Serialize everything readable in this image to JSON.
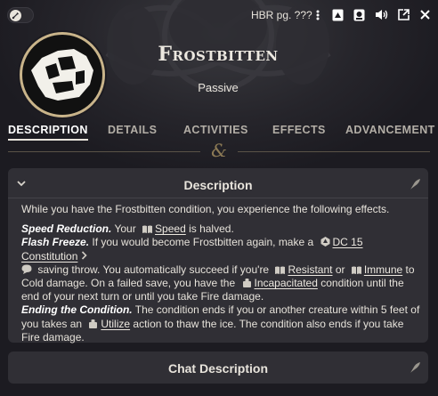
{
  "topbar": {
    "source_label": "HBR pg. ???",
    "icons": [
      "wrench-toggle-icon",
      "menu-dots-icon",
      "open-book-icon",
      "token-icon",
      "volume-icon",
      "pop-out-icon",
      "close-icon"
    ]
  },
  "header": {
    "name": "Frostbitten",
    "type": "Passive"
  },
  "tabs": [
    {
      "label": "DESCRIPTION",
      "active": true
    },
    {
      "label": "DETAILS",
      "active": false
    },
    {
      "label": "ACTIVITIES",
      "active": false
    },
    {
      "label": "EFFECTS",
      "active": false
    },
    {
      "label": "ADVANCEMENT",
      "active": false
    }
  ],
  "divider_glyph": "&",
  "description": {
    "title": "Description",
    "intro": "While you have the Frostbitten condition, you experience the following effects.",
    "speed_title": "Speed Reduction.",
    "speed_pre": " Your ",
    "speed_ref": "Speed",
    "speed_post": " is halved.",
    "flash_title": "Flash Freeze.",
    "flash_pre": " If you would become Frostbitten again, make a ",
    "flash_dc": "DC 15 Constitution",
    "flash_mid1": " saving throw. You automatically succeed if you're ",
    "flash_ref1": "Resistant",
    "flash_or": " or ",
    "flash_ref2": "Immune",
    "flash_mid2": " to Cold damage. On a failed save, you have the ",
    "flash_ref3": "Incapacitated",
    "flash_post": " condition until the end of your next turn or until you take Fire damage.",
    "ending_title": "Ending the Condition.",
    "ending_pre": " The condition ends if you or another creature within 5 feet of you takes an ",
    "ending_ref": "Utilize",
    "ending_post": " action to thaw the ice. The condition also ends if you take Fire damage."
  },
  "chat": {
    "title": "Chat Description"
  },
  "colors": {
    "background": "#1c1b21",
    "card": "#302f35",
    "accent_gold": "#c9b48a"
  }
}
